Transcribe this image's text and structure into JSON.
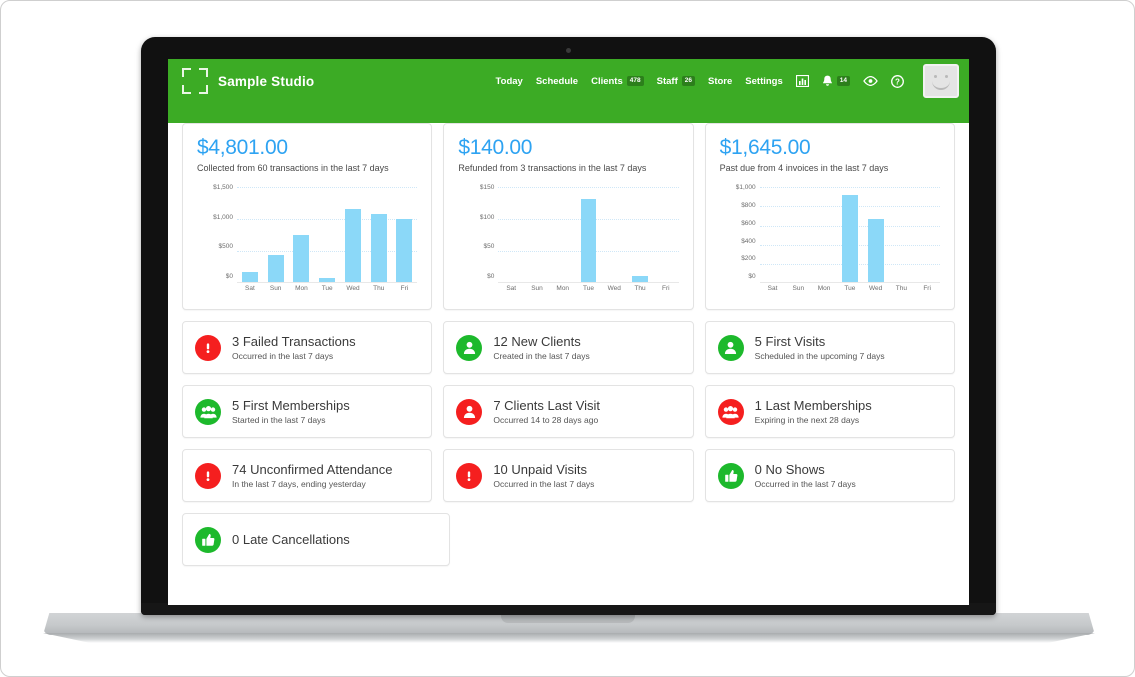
{
  "header": {
    "brand_name": "Sample Studio",
    "brand_icon": "crop-frame-icon",
    "background_color": "#3cab25",
    "nav": [
      {
        "label": "Today",
        "badge": null
      },
      {
        "label": "Schedule",
        "badge": null
      },
      {
        "label": "Clients",
        "badge": "478"
      },
      {
        "label": "Staff",
        "badge": "26"
      },
      {
        "label": "Store",
        "badge": null
      },
      {
        "label": "Settings",
        "badge": null
      }
    ],
    "icons": [
      {
        "name": "reports-chart-icon",
        "glyph": "▥"
      },
      {
        "name": "notifications-bell-icon",
        "glyph": "🔔",
        "badge": "14"
      },
      {
        "name": "eye-preview-icon",
        "glyph": "◉"
      },
      {
        "name": "help-question-icon",
        "glyph": "?"
      }
    ],
    "avatar_name": "user-avatar"
  },
  "charts": [
    {
      "amount": "$4,801.00",
      "subtitle": "Collected from 60 transactions in the last 7 days",
      "chart_data": {
        "type": "bar",
        "title": "$4,801.00",
        "xlabel": "",
        "ylabel": "",
        "categories": [
          "Sat",
          "Sun",
          "Mon",
          "Tue",
          "Wed",
          "Thu",
          "Fri"
        ],
        "values": [
          160,
          430,
          730,
          60,
          1150,
          1060,
          980
        ],
        "ytick_labels": [
          "$1,500",
          "$1,000",
          "$500",
          "$0"
        ],
        "ytick_values": [
          1500,
          1000,
          500,
          0
        ],
        "ylim": [
          0,
          1500
        ],
        "grid": true,
        "legend": "none",
        "bar_color": "#8bd8f8"
      }
    },
    {
      "amount": "$140.00",
      "subtitle": "Refunded from 3 transactions in the last 7 days",
      "chart_data": {
        "type": "bar",
        "title": "$140.00",
        "xlabel": "",
        "ylabel": "",
        "categories": [
          "Sat",
          "Sun",
          "Mon",
          "Tue",
          "Wed",
          "Thu",
          "Fri"
        ],
        "values": [
          0,
          0,
          0,
          130,
          0,
          10,
          0
        ],
        "ytick_labels": [
          "$150",
          "$100",
          "$50",
          "$0"
        ],
        "ytick_values": [
          150,
          100,
          50,
          0
        ],
        "ylim": [
          0,
          150
        ],
        "grid": true,
        "legend": "none",
        "bar_color": "#8bd8f8"
      }
    },
    {
      "amount": "$1,645.00",
      "subtitle": "Past due from 4 invoices in the last 7 days",
      "chart_data": {
        "type": "bar",
        "title": "$1,645.00",
        "xlabel": "",
        "ylabel": "",
        "categories": [
          "Sat",
          "Sun",
          "Mon",
          "Tue",
          "Wed",
          "Thu",
          "Fri"
        ],
        "values": [
          0,
          0,
          0,
          910,
          660,
          0,
          0
        ],
        "ytick_labels": [
          "$1,000",
          "$800",
          "$600",
          "$400",
          "$200",
          "$0"
        ],
        "ytick_values": [
          1000,
          800,
          600,
          400,
          200,
          0
        ],
        "ylim": [
          0,
          1000
        ],
        "grid": true,
        "legend": "none",
        "bar_color": "#8bd8f8"
      }
    }
  ],
  "stats": [
    [
      {
        "title": "3 Failed Transactions",
        "sub": "Occurred in the last 7 days",
        "icon": "alert-exclamation-icon",
        "color": "red"
      },
      {
        "title": "12 New Clients",
        "sub": "Created in the last 7 days",
        "icon": "person-icon",
        "color": "green"
      },
      {
        "title": "5 First Visits",
        "sub": "Scheduled in the upcoming 7 days",
        "icon": "person-icon",
        "color": "green"
      }
    ],
    [
      {
        "title": "5 First Memberships",
        "sub": "Started in the last 7 days",
        "icon": "people-group-icon",
        "color": "green"
      },
      {
        "title": "7 Clients Last Visit",
        "sub": "Occurred 14 to 28 days ago",
        "icon": "person-icon",
        "color": "red"
      },
      {
        "title": "1 Last Memberships",
        "sub": "Expiring in the next 28 days",
        "icon": "people-group-icon",
        "color": "red"
      }
    ],
    [
      {
        "title": "74 Unconfirmed Attendance",
        "sub": "In the last 7 days, ending yesterday",
        "icon": "alert-exclamation-icon",
        "color": "red"
      },
      {
        "title": "10 Unpaid Visits",
        "sub": "Occurred in the last 7 days",
        "icon": "alert-exclamation-icon",
        "color": "red"
      },
      {
        "title": "0 No Shows",
        "sub": "Occurred in the last 7 days",
        "icon": "thumbs-up-icon",
        "color": "green"
      }
    ]
  ],
  "stats_partial": [
    {
      "title": "0 Late Cancellations",
      "sub": "",
      "icon": "thumbs-up-icon",
      "color": "green"
    }
  ],
  "colors": {
    "brand_green": "#3cab25",
    "accent_blue": "#2ea3f2",
    "bar_blue": "#8bd8f8",
    "alert_red": "#f51f1f",
    "ok_green": "#1db92c"
  }
}
